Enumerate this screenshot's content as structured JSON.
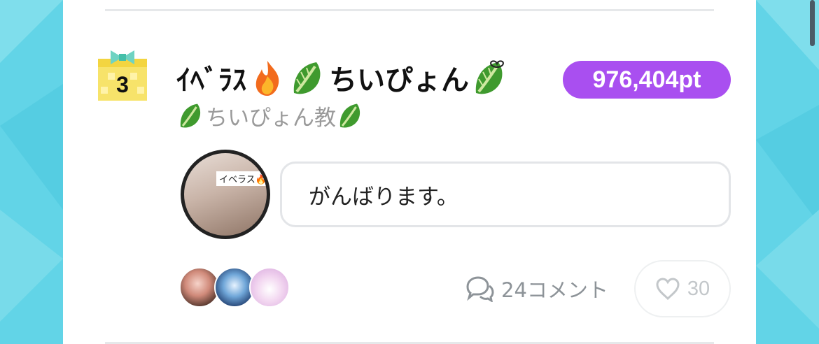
{
  "entry": {
    "rank": "3",
    "name_prefix": "ｲﾍﾞﾗｽ",
    "name_main": "ちいぴょん",
    "points": "976,404pt",
    "subtitle_text": "ちいぴょん教",
    "avatar_tag": "イベラス🔥‼",
    "message": "がんばります。",
    "comment_count_label": "24コメント",
    "like_count": "30"
  },
  "icons": {
    "rank": "gift-box-icon",
    "fire": "fire-emoji-icon",
    "leaf": "leafy-green-emoji-icon",
    "comments": "speech-bubbles-icon",
    "like": "heart-outline-icon"
  },
  "colors": {
    "points_badge": "#a94ff0",
    "background": "#5fd3e6",
    "muted_text": "#9a9a9a"
  }
}
